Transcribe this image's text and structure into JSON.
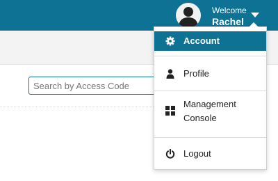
{
  "header": {
    "welcome_text": "Welcome",
    "user_name": "Rachel",
    "bar_color": "#0d7294"
  },
  "search": {
    "placeholder": "Search by Access Code",
    "value": ""
  },
  "user_dropdown": {
    "items": [
      {
        "label": "Account",
        "icon": "gear-icon",
        "active": true
      },
      {
        "label": "Profile",
        "icon": "person-icon",
        "active": false
      },
      {
        "label": "Management Console",
        "icon": "grid-icon",
        "active": false
      },
      {
        "label": "Logout",
        "icon": "power-icon",
        "active": false
      }
    ],
    "active_color": "#0d7294"
  }
}
